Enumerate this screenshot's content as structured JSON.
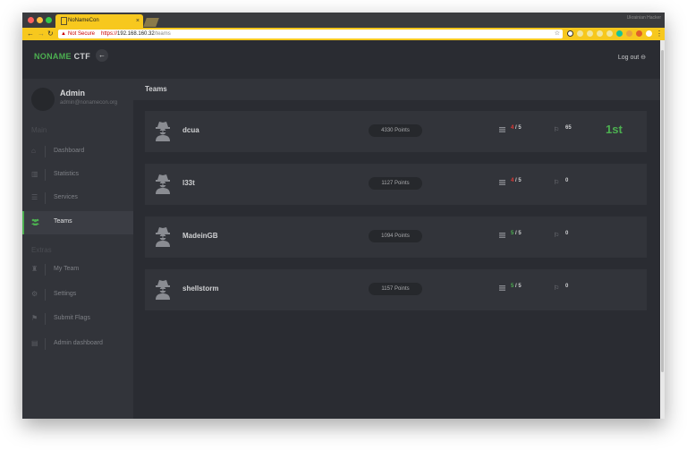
{
  "browser": {
    "tab_title": "NoNameCon",
    "tab_close": "×",
    "profile_label": "Ukrainian Hacker",
    "security_label": "Not Secure",
    "url_scheme": "https://",
    "url_host": "192.168.160.32",
    "url_path": "/teams",
    "colors": {
      "chrome": "#f7c81e",
      "tabbar": "#3a3b3e"
    },
    "dots": [
      "#fc605c",
      "#fdbc40",
      "#34c84a"
    ]
  },
  "app": {
    "brand_part1": "NONAME",
    "brand_part2": "CTF",
    "back_icon": "←",
    "logout_label": "Log out ⊖",
    "accent": "#4caf50"
  },
  "sidebar": {
    "user_name": "Admin",
    "user_email": "admin@nonamecon.org",
    "sections": [
      "Main",
      "Extras"
    ],
    "items": [
      {
        "label": "Dashboard",
        "icon": "home-icon",
        "glyph": "⌂"
      },
      {
        "label": "Statistics",
        "icon": "chart-icon",
        "glyph": "▥"
      },
      {
        "label": "Services",
        "icon": "list-icon",
        "glyph": "☰"
      },
      {
        "label": "Teams",
        "icon": "users-icon",
        "glyph": "👥",
        "active": true
      },
      {
        "label": "My Team",
        "icon": "spy-icon",
        "glyph": "♜"
      },
      {
        "label": "Settings",
        "icon": "gear-icon",
        "glyph": "⚙"
      },
      {
        "label": "Submit Flags",
        "icon": "flag-icon",
        "glyph": "⚑"
      },
      {
        "label": "Admin dashboard",
        "icon": "admin-chart-icon",
        "glyph": "▤"
      }
    ]
  },
  "main": {
    "title": "Teams",
    "teams": [
      {
        "name": "dcua",
        "points": "4330 Points",
        "services_up": "4",
        "services_total": "5",
        "services_ok": false,
        "flags": "65",
        "rank": "1st"
      },
      {
        "name": "l33t",
        "points": "1127 Points",
        "services_up": "4",
        "services_total": "5",
        "services_ok": false,
        "flags": "0",
        "rank": ""
      },
      {
        "name": "MadeinGB",
        "points": "1094 Points",
        "services_up": "5",
        "services_total": "5",
        "services_ok": true,
        "flags": "0",
        "rank": ""
      },
      {
        "name": "shellstorm",
        "points": "1157 Points",
        "services_up": "5",
        "services_total": "5",
        "services_ok": true,
        "flags": "0",
        "rank": ""
      }
    ]
  }
}
